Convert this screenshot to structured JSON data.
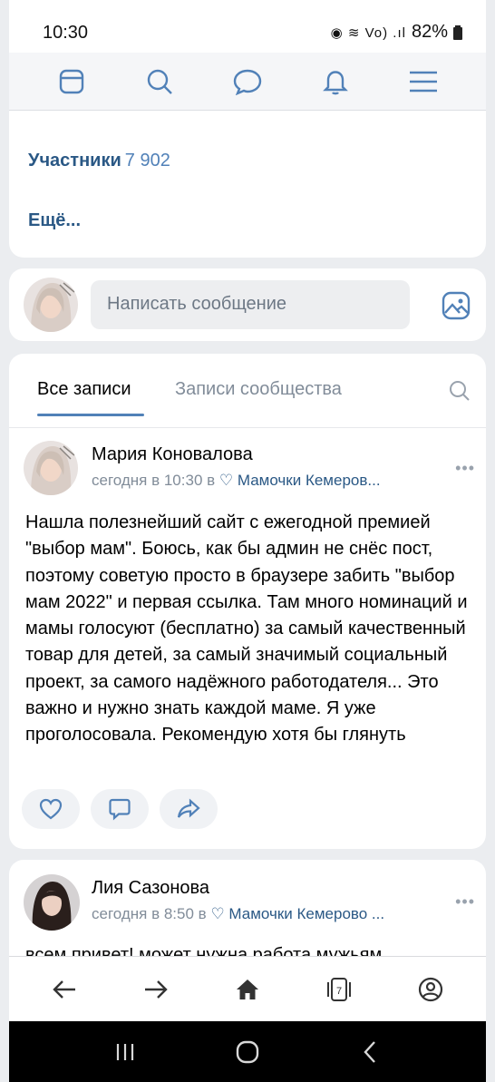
{
  "status_bar": {
    "time": "10:30",
    "icons": "◉ ≋ Vo) .ıl",
    "battery": "82%"
  },
  "top_nav": {
    "items": [
      "feed-icon",
      "search-icon",
      "messages-icon",
      "notifications-icon",
      "menu-icon"
    ]
  },
  "group_info": {
    "members_label": "Участники",
    "members_count": "7 902",
    "more_label": "Ещё..."
  },
  "composer": {
    "placeholder": "Написать сообщение"
  },
  "wall": {
    "tabs": [
      "Все записи",
      "Записи сообщества"
    ],
    "active_tab": "Все записи"
  },
  "posts": [
    {
      "author": "Мария Коновалова",
      "time": "сегодня в 10:30",
      "in_word": " в ",
      "group": "♡ Мамочки Кемеров...",
      "text": "Нашла полезнейший сайт с ежегодной премией \"выбор мам\". Боюсь, как бы админ не снёс пост, поэтому советую просто в браузере забить \"выбор мам 2022\" и первая ссылка. Там много номинаций и мамы голосуют (бесплатно) за самый качественный товар для детей, за самый значимый социальный проект, за самого надёжного работодателя... Это важно и нужно знать каждой маме. Я уже проголосовала. Рекомендую хотя бы глянуть"
    },
    {
      "author": "Лия Сазонова",
      "time": "сегодня в 8:50",
      "in_word": " в ",
      "group": "♡ Мамочки Кемерово ...",
      "text": "всем привет! может нужна работа мужьям"
    }
  ],
  "more_dots": "•••",
  "browser_bar": {
    "tabs_count": "7"
  },
  "colors": {
    "accent": "#2a5885",
    "link": "#5181b8",
    "secondary_text": "#818c99",
    "background": "#ebedf0"
  }
}
